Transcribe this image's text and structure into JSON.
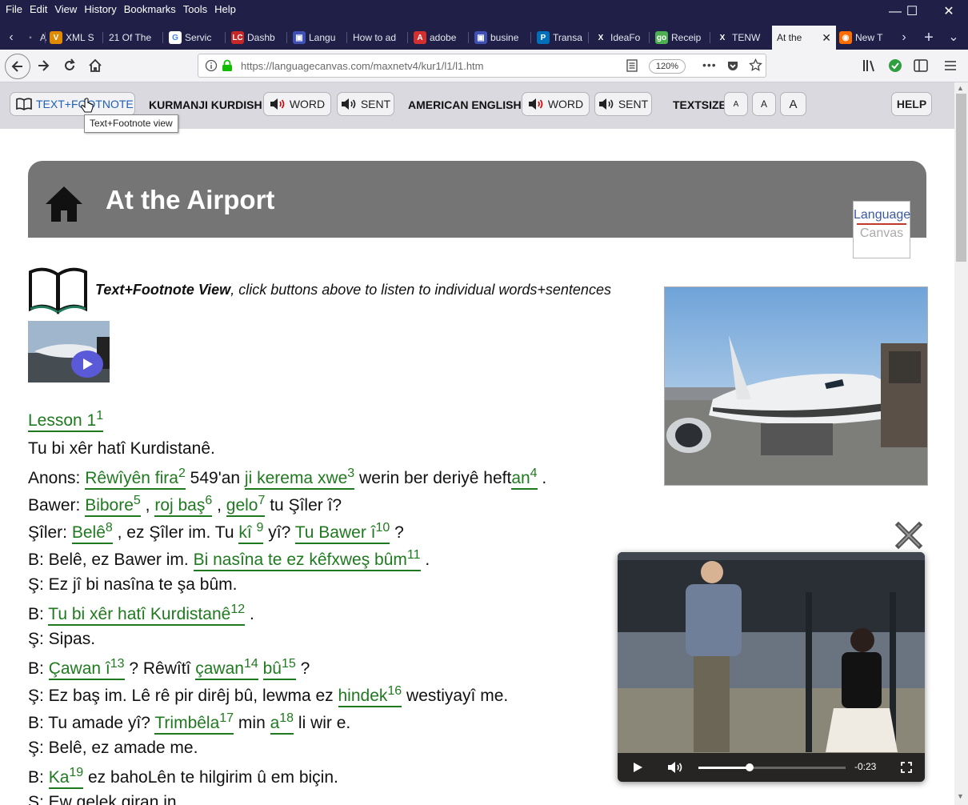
{
  "menu": [
    "File",
    "Edit",
    "View",
    "History",
    "Bookmarks",
    "Tools",
    "Help"
  ],
  "window_controls": {
    "minimize": "—",
    "maximize": "☐",
    "close": "✕"
  },
  "tabs": [
    {
      "label": "A",
      "fav": "◦",
      "color": "#1f1f47"
    },
    {
      "label": "XML S",
      "fav": "V",
      "color": "#e08a00"
    },
    {
      "label": "21 Of The",
      "fav": "",
      "color": "#1f1f47"
    },
    {
      "label": "Servic",
      "fav": "G",
      "color": "#ffffff"
    },
    {
      "label": "Dashb",
      "fav": "LC",
      "color": "#c62828"
    },
    {
      "label": "Langu",
      "fav": "▣",
      "color": "#3f51b5"
    },
    {
      "label": "How to ad",
      "fav": "",
      "color": "#1f1f47"
    },
    {
      "label": "adobe",
      "fav": "A",
      "color": "#d32f2f"
    },
    {
      "label": "busine",
      "fav": "▣",
      "color": "#3f51b5"
    },
    {
      "label": "Transa",
      "fav": "P",
      "color": "#0070ba"
    },
    {
      "label": "IdeaFo",
      "fav": "X",
      "color": "#1f1f47"
    },
    {
      "label": "Receip",
      "fav": "go",
      "color": "#4caf50"
    },
    {
      "label": "TENW",
      "fav": "X",
      "color": "#1f1f47"
    },
    {
      "label": "At the",
      "fav": "",
      "color": "#f3f3f5",
      "active": true
    },
    {
      "label": "New T",
      "fav": "◉",
      "color": "#ff6d00"
    }
  ],
  "tab_controls": {
    "scroll_left": "‹",
    "scroll_right": "›",
    "new_tab": "+",
    "list_all": "⌄",
    "close_tab": "✕"
  },
  "nav": {
    "url": "https://languagecanvas.com/maxnetv4/kur1/l1/l1.htm",
    "zoom": "120%",
    "more": "•••"
  },
  "toolbar": {
    "text_footnote": "TEXT+FOOTNOTE",
    "lang1": "KURMANJI KURDISH",
    "word": "WORD",
    "sent": "SENT",
    "lang2": "AMERICAN ENGLISH",
    "textsize": "TEXTSIZE",
    "size_small": "A",
    "size_medium": "A",
    "size_large": "A",
    "help": "HELP"
  },
  "tooltip": "Text+Footnote view",
  "page": {
    "title": "At the Airport",
    "logo_line1": "Language",
    "logo_line2": "Canvas",
    "view_note_bold": "Text+Footnote View",
    "view_note_rest": ", click buttons above to listen to individual words+sentences"
  },
  "lines": [
    [
      {
        "fn": "Lesson 1",
        "n": "1"
      }
    ],
    [
      {
        "t": "Tu bi xêr hatî Kurdistanê."
      }
    ],
    [
      {
        "t": "Anons: "
      },
      {
        "fn": "Rêwîyên fira",
        "n": "2"
      },
      {
        "t": " 549'an "
      },
      {
        "fn": "ji kerema xwe",
        "n": "3"
      },
      {
        "t": " werin ber deriyê heft"
      },
      {
        "fn": "an",
        "n": "4"
      },
      {
        "t": " ."
      }
    ],
    [
      {
        "t": "Bawer: "
      },
      {
        "fn": "Bibore",
        "n": "5"
      },
      {
        "t": " , "
      },
      {
        "fn": "roj baş",
        "n": "6"
      },
      {
        "t": " , "
      },
      {
        "fn": "gelo",
        "n": "7"
      },
      {
        "t": " tu Şîler î?"
      }
    ],
    [
      {
        "t": "Şîler: "
      },
      {
        "fn": "Belê",
        "n": "8"
      },
      {
        "t": " , ez Şîler im. Tu "
      },
      {
        "fn": "kî ",
        "n": "9"
      },
      {
        "t": " yî? "
      },
      {
        "fn": "Tu Bawer î",
        "n": "10"
      },
      {
        "t": " ?"
      }
    ],
    [
      {
        "t": "B: Belê, ez Bawer im. "
      },
      {
        "fn": "Bi nasîna te ez kêfxweş bûm",
        "n": "11"
      },
      {
        "t": " ."
      }
    ],
    [
      {
        "t": "Ş: Ez jî bi nasîna te şa bûm."
      }
    ],
    [
      {
        "t": "B: "
      },
      {
        "fn": "Tu bi xêr hatî Kurdistanê",
        "n": "12"
      },
      {
        "t": " ."
      }
    ],
    [
      {
        "t": "Ş: Sipas."
      }
    ],
    [
      {
        "t": "B: "
      },
      {
        "fn": "Çawan î",
        "n": "13"
      },
      {
        "t": " ? Rêwîtî "
      },
      {
        "fn": "çawan",
        "n": "14"
      },
      {
        "t": " "
      },
      {
        "fn": "bû",
        "n": "15"
      },
      {
        "t": " ?"
      }
    ],
    [
      {
        "t": "Ş: Ez baş im. Lê rê pir dirêj bû, lewma ez "
      },
      {
        "fn": "hindek",
        "n": "16"
      },
      {
        "t": " westiyayî me."
      }
    ],
    [
      {
        "t": "B: Tu amade yî? "
      },
      {
        "fn": "Trimbêla",
        "n": "17"
      },
      {
        "t": " min "
      },
      {
        "fn": "a",
        "n": "18"
      },
      {
        "t": " li wir e."
      }
    ],
    [
      {
        "t": "Ş: Belê, ez amade me."
      }
    ],
    [
      {
        "t": "B: "
      },
      {
        "fn": "Ka",
        "n": "19"
      },
      {
        "t": " ez bahoLên te hilgirim û em biçin."
      }
    ],
    [
      {
        "t": "Ş: Ew gelek giran in."
      }
    ]
  ],
  "video": {
    "time": "-0:23",
    "progress": 0.35
  },
  "colors": {
    "footnote_green": "#1f7a1f",
    "header_gray": "#757575",
    "tab_bg": "#1f1f47",
    "toolbar_bg": "#d9d9df"
  }
}
